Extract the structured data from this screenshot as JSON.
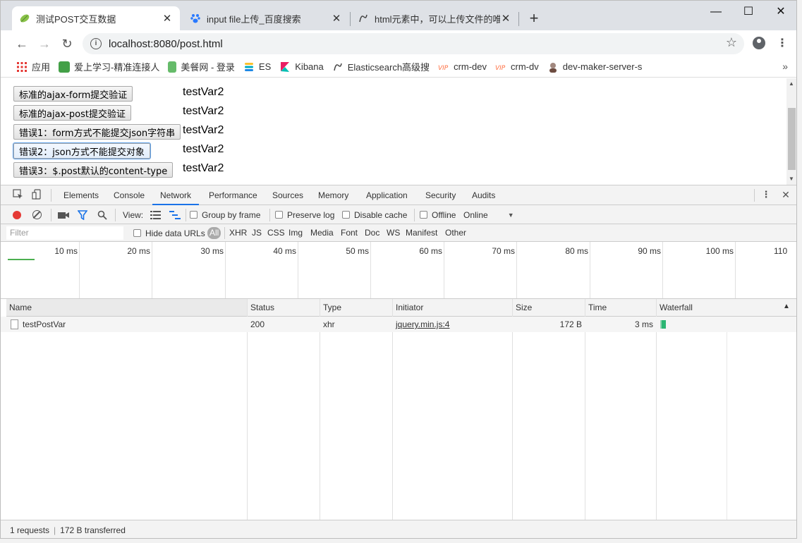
{
  "tabs": [
    {
      "title": "测试POST交互数据",
      "favicon": "leaf-icon",
      "active": true
    },
    {
      "title": "input file上传_百度搜索",
      "favicon": "baidu-paw-icon",
      "active": false
    },
    {
      "title": "html元素中，可以上传文件的唯",
      "favicon": "webpage-icon",
      "active": false
    }
  ],
  "address_bar": {
    "url": "localhost:8080/post.html"
  },
  "bookmarks": [
    {
      "label": "应用",
      "icon": "apps-grid-icon",
      "color": "#e53935"
    },
    {
      "label": "爱上学习-精准连接人",
      "icon": "bookmark-green-icon",
      "color": "#43a047"
    },
    {
      "label": "美餐网 - 登录",
      "icon": "meican-icon",
      "color": "#4caf50"
    },
    {
      "label": "ES",
      "icon": "elastic-icon",
      "color": "#00bcd4"
    },
    {
      "label": "Kibana",
      "icon": "kibana-icon",
      "color": "#e91e63"
    },
    {
      "label": "Elasticsearch高级搜",
      "icon": "webpage-icon",
      "color": "#555555"
    },
    {
      "label": "crm-dev",
      "icon": "vip-icon",
      "color": "#ff7043"
    },
    {
      "label": "crm-dv",
      "icon": "vip-icon",
      "color": "#ff7043"
    },
    {
      "label": "dev-maker-server-s",
      "icon": "avatar-icon",
      "color": "#8d6e63"
    }
  ],
  "page": {
    "rows": [
      {
        "button": "标准的ajax-form提交验证",
        "result": "testVar2"
      },
      {
        "button": "标准的ajax-post提交验证",
        "result": "testVar2"
      },
      {
        "button": "错误1：form方式不能提交json字符串",
        "result": "testVar2"
      },
      {
        "button": "错误2：json方式不能提交对象",
        "result": "testVar2"
      },
      {
        "button": "错误3：$.post默认的content-type",
        "result": "testVar2"
      }
    ]
  },
  "devtools": {
    "tabs": [
      "Elements",
      "Console",
      "Network",
      "Performance",
      "Sources",
      "Memory",
      "Application",
      "Security",
      "Audits"
    ],
    "active_tab": "Network",
    "toolbar": {
      "view_label": "View:",
      "group_by_frame": "Group by frame",
      "preserve_log": "Preserve log",
      "disable_cache": "Disable cache",
      "offline": "Offline",
      "throttling": "Online"
    },
    "filter": {
      "placeholder": "Filter",
      "hide_data_urls": "Hide data URLs",
      "types": [
        "All",
        "XHR",
        "JS",
        "CSS",
        "Img",
        "Media",
        "Font",
        "Doc",
        "WS",
        "Manifest",
        "Other"
      ],
      "selected_type": "All"
    },
    "overview_ticks": [
      "10 ms",
      "20 ms",
      "30 ms",
      "40 ms",
      "50 ms",
      "60 ms",
      "70 ms",
      "80 ms",
      "90 ms",
      "100 ms",
      "110"
    ],
    "columns": [
      "Name",
      "Status",
      "Type",
      "Initiator",
      "Size",
      "Time",
      "Waterfall"
    ],
    "requests": [
      {
        "name": "testPostVar",
        "status": "200",
        "type": "xhr",
        "initiator": "jquery.min.js:4",
        "size": "172 B",
        "time": "3 ms"
      }
    ],
    "summary": {
      "requests": "1 requests",
      "transferred": "172 B transferred"
    }
  }
}
